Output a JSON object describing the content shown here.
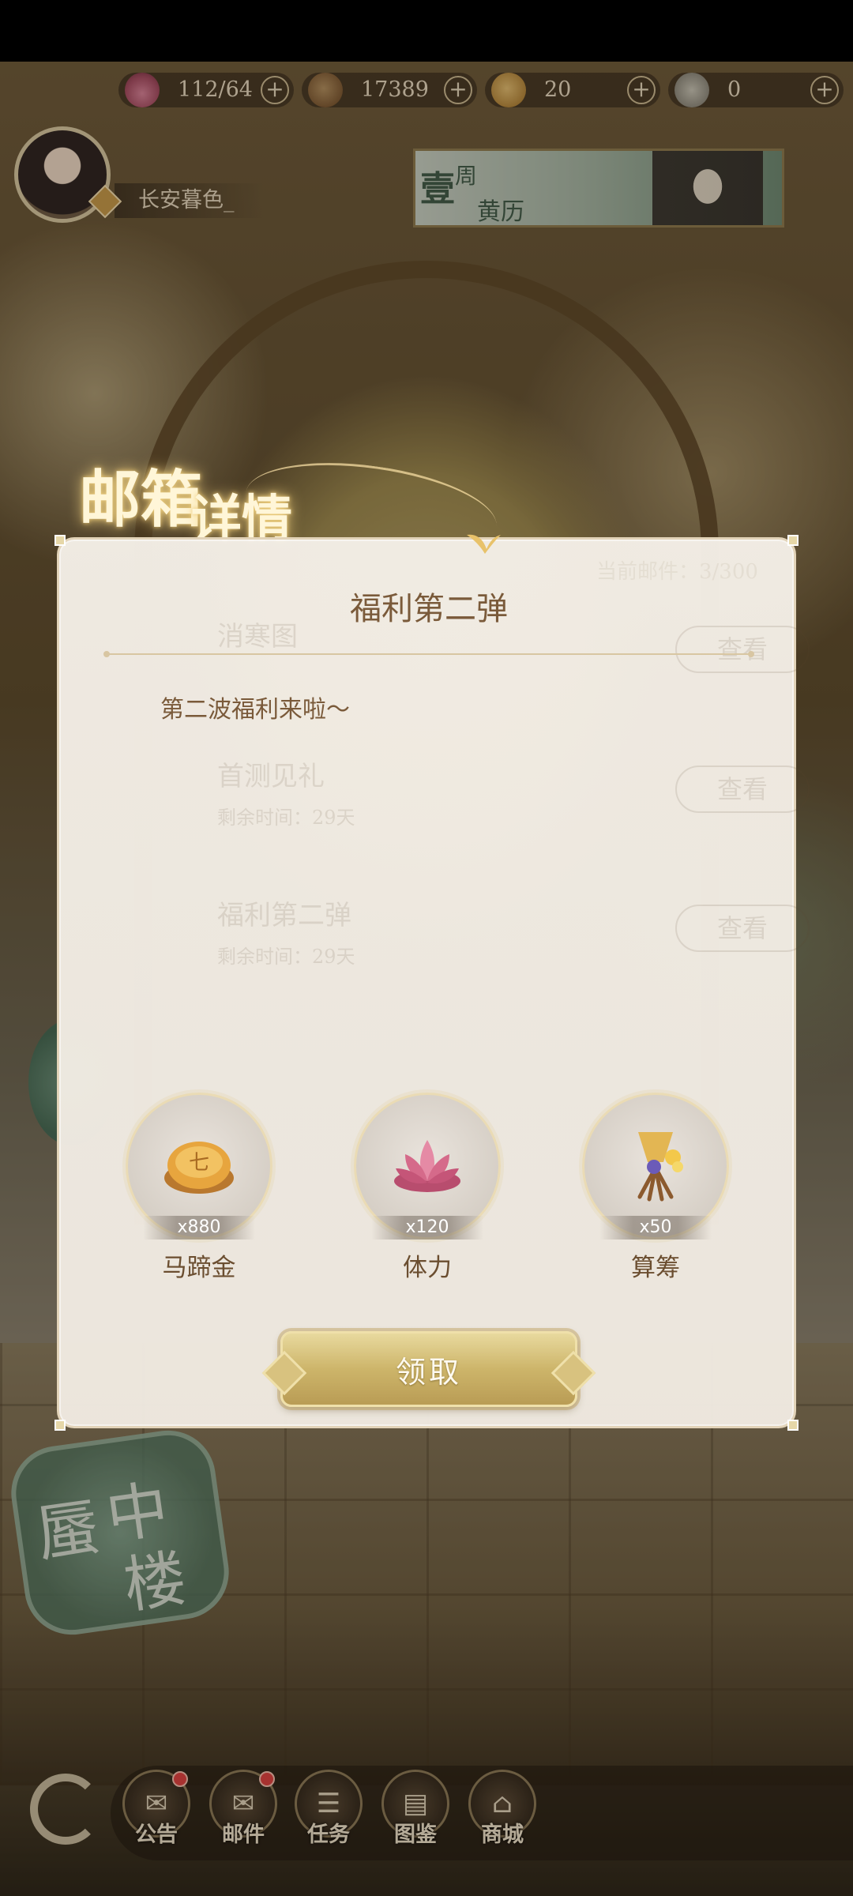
{
  "currency": [
    {
      "icon": "lotus-stamina-icon",
      "value": "112/64"
    },
    {
      "icon": "copper-coin-icon",
      "value": "17389"
    },
    {
      "icon": "gold-ingot-icon",
      "value": "20"
    },
    {
      "icon": "tea-cup-icon",
      "value": "0"
    }
  ],
  "currency_plus": "+",
  "player": {
    "name": "长安暮色_"
  },
  "calendar": {
    "big": "壹",
    "week": "周",
    "label": "黄历"
  },
  "mailbox": {
    "title_part1": "邮箱",
    "title_part2": "详情",
    "count_text": "当前邮件：3/300",
    "background_list": [
      {
        "name": "消寒图",
        "sub": "",
        "action": "查看"
      },
      {
        "name": "首测见礼",
        "sub": "剩余时间：29天",
        "action": "查看"
      },
      {
        "name": "福利第二弹",
        "sub": "剩余时间：29天",
        "action": "查看"
      }
    ]
  },
  "modal": {
    "title": "福利第二弹",
    "body": "第二波福利来啦～",
    "rewards": [
      {
        "label": "马蹄金",
        "count": "x880",
        "icon": "horseshoe-gold-icon"
      },
      {
        "label": "体力",
        "count": "x120",
        "icon": "lotus-flower-icon"
      },
      {
        "label": "算筹",
        "count": "x50",
        "icon": "counting-rods-icon"
      }
    ],
    "claim_label": "领取"
  },
  "side_badge": {
    "line1": "蜃",
    "line2": "中",
    "line3": "楼"
  },
  "bottom_nav": [
    {
      "label": "公告",
      "badge": true
    },
    {
      "label": "邮件",
      "badge": true
    },
    {
      "label": "任务",
      "badge": false
    },
    {
      "label": "图鉴",
      "badge": false
    },
    {
      "label": "商城",
      "badge": false
    }
  ],
  "colors": {
    "modal_bg": "#f3eee6",
    "accent_gold": "#cdb56a",
    "text_brown": "#7a5a3a"
  }
}
